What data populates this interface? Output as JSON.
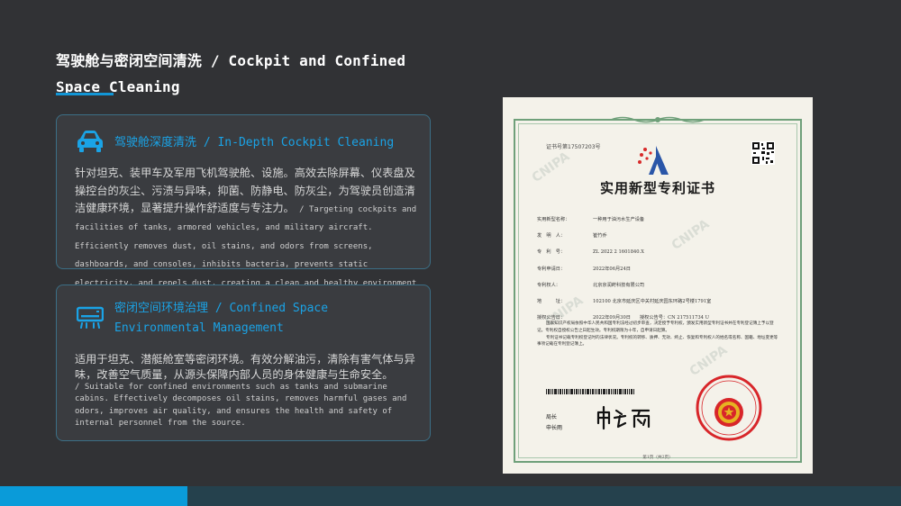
{
  "page": {
    "title": "驾驶舱与密闭空间清洗 / Cockpit and Confined Space Cleaning"
  },
  "cards": [
    {
      "icon": "car-icon",
      "heading": "驾驶舱深度清洗 / In-Depth Cockpit Cleaning",
      "body_cn": "针对坦克、装甲车及军用飞机驾驶舱、设施。高效去除屏幕、仪表盘及操控台的灰尘、污渍与异味，抑菌、防静电、防灰尘，为驾驶员创造清洁健康环境，显著提升操作舒适度与专注力。",
      "body_en": " / Targeting cockpits and facilities of tanks, armored vehicles, and military aircraft. Efficiently removes dust, oil stains, and odors from screens, dashboards, and consoles, inhibits bacteria, prevents static electricity, and repels dust, creating a clean and healthy environment for drivers and significantly improving operational comfort and concentration."
    },
    {
      "icon": "air-conditioner-icon",
      "heading": "密闭空间环境治理 / Confined Space Environmental Management",
      "body_cn": "适用于坦克、潜艇舱室等密闭环境。有效分解油污，清除有害气体与异味，改善空气质量，从源头保障内部人员的身体健康与生命安全。",
      "body_en": "/ Suitable for confined environments such as tanks and submarine cabins. Effectively decomposes oil stains, removes harmful gases and odors, improves air quality, and ensures the health and safety of internal personnel from the source."
    }
  ],
  "certificate": {
    "number": "证书号第17507203号",
    "title": "实用新型专利证书",
    "fields": [
      {
        "label": "实用新型名称：",
        "value": "一种用于油污水生产设备"
      },
      {
        "label": "发　明　人：",
        "value": "崔竹乔"
      },
      {
        "label": "专　利　号：",
        "value": "ZL 2022 2 1601840.X"
      },
      {
        "label": "专利申请日：",
        "value": "2022年06月24日"
      },
      {
        "label": "专利权人：",
        "value": "北京京润莳科技有限公司"
      },
      {
        "label": "地　　　址：",
        "value": "102100 北京市延庆区中关村延庆园东环路2号楼1791室"
      },
      {
        "label": "授权公告日：",
        "value": "2022年09月30日",
        "label2": "授权公告号：",
        "value2": "CN 217511734 U"
      }
    ],
    "paragraph_1": "国家知识产权局依照中华人民共和国专利法经过初步审查，决定授予专利权，颁发实用新型专利证书并在专利登记簿上予以登记。专利权自授权公告之日起生效。专利权期限为十年，自申请日起算。",
    "paragraph_2": "专利证书记载专利权登记时的法律状况。专利权的转移、质押、无效、终止、恢复和专利权人的姓名或名称、国籍、地址变更等事项记载在专利登记簿上。",
    "signature_label_1": "局长",
    "signature_label_2": "申长雨",
    "signature": "申长雨",
    "seal_text": "国家知识产权局",
    "page": "第1页（共2页）",
    "watermark": "CNIPA"
  },
  "colors": {
    "background": "#313235",
    "accent": "#1296d6",
    "heading": "#1aa3e6",
    "card_border": "#3c6f86",
    "bottom_bar": "#25414d",
    "bottom_accent": "#0a9bd9"
  }
}
